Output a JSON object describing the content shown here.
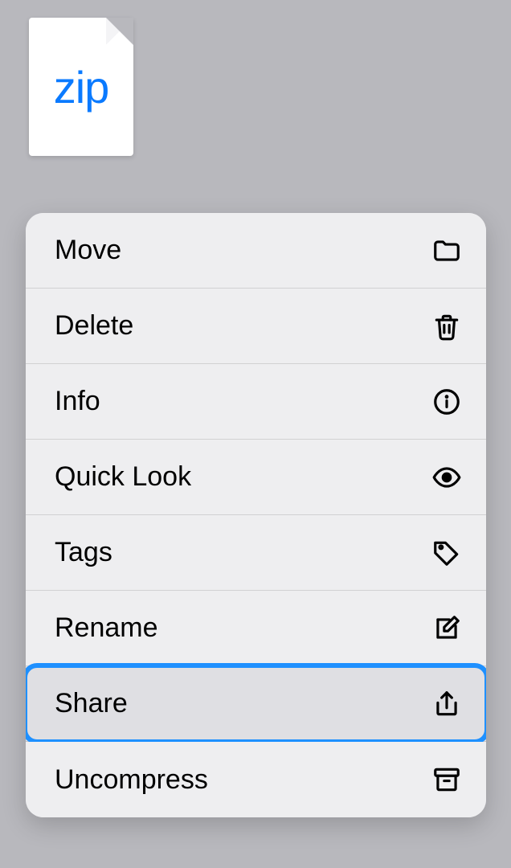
{
  "file": {
    "type_label": "zip"
  },
  "menu": {
    "items": [
      {
        "label": "Move",
        "icon": "folder-icon"
      },
      {
        "label": "Delete",
        "icon": "trash-icon"
      },
      {
        "label": "Info",
        "icon": "info-icon"
      },
      {
        "label": "Quick Look",
        "icon": "eye-icon"
      },
      {
        "label": "Tags",
        "icon": "tag-icon"
      },
      {
        "label": "Rename",
        "icon": "compose-icon"
      },
      {
        "label": "Share",
        "icon": "share-icon",
        "highlighted": true
      },
      {
        "label": "Uncompress",
        "icon": "archive-box-icon"
      }
    ]
  }
}
